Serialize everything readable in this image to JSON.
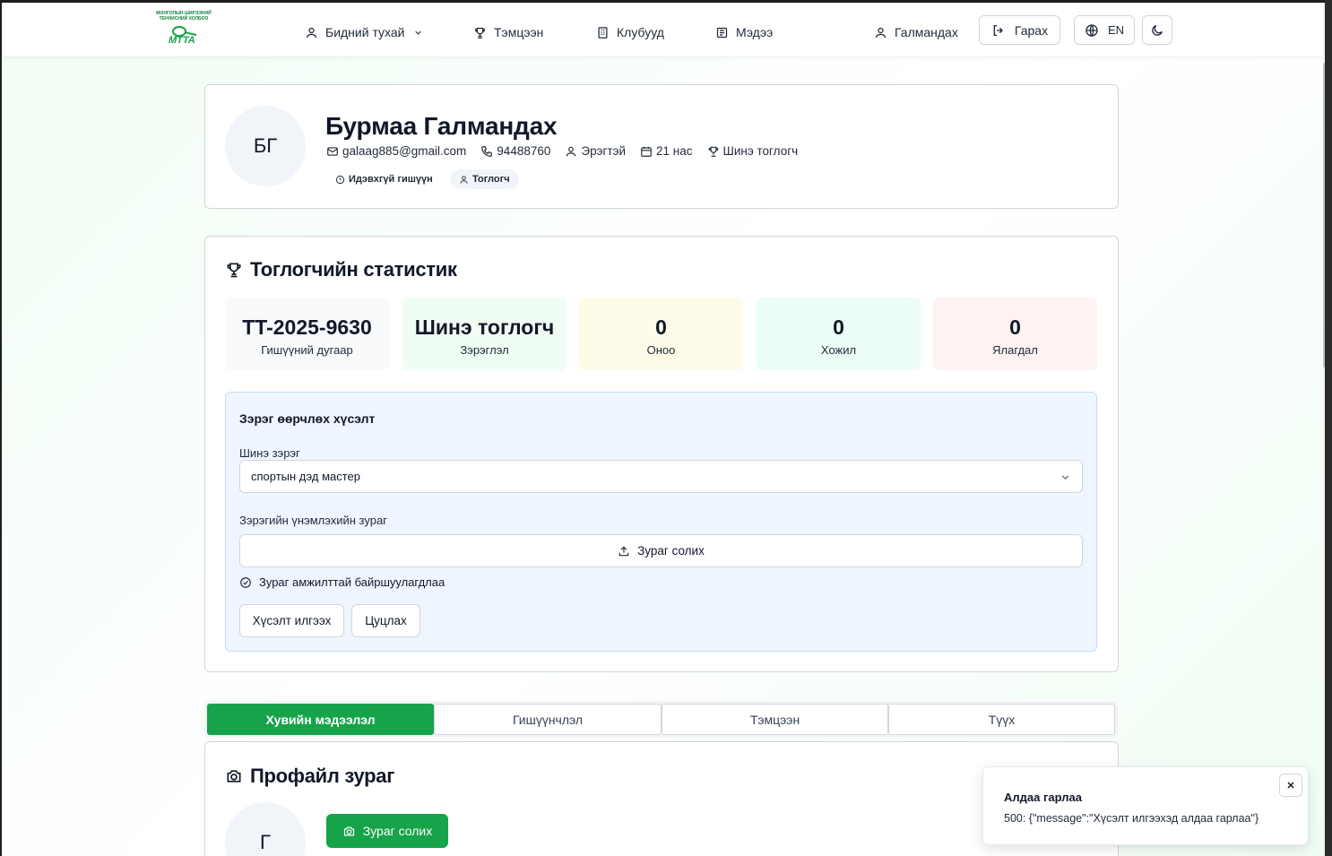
{
  "header": {
    "logo_caption": "МОНГОЛЫН ШИРЭЭНИЙ ТЕННИСНИЙ ХОЛБОО",
    "logo_text": "MTTA",
    "nav": {
      "about": "Бидний тухай",
      "tournaments": "Тэмцээн",
      "clubs": "Клубууд",
      "news": "Мэдээ"
    },
    "user_name": "Галмандах",
    "logout": "Гарах",
    "language": "EN"
  },
  "profile": {
    "initials": "БГ",
    "full_name": "Бурмаа Галмандах",
    "email": "galaag885@gmail.com",
    "phone": "94488760",
    "gender": "Эрэгтэй",
    "age": "21 нас",
    "rank": "Шинэ тоглогч",
    "status_badge": "Идэвхгүй гишүүн",
    "role_badge": "Тоглогч"
  },
  "stats": {
    "title": "Тоглогчийн статистик",
    "items": [
      {
        "value": "TT-2025-9630",
        "label": "Гишүүний дугаар",
        "color": "#f8fafc"
      },
      {
        "value": "Шинэ тоглогч",
        "label": "Зэрэглэл",
        "color": "#f0fdf4"
      },
      {
        "value": "0",
        "label": "Оноо",
        "color": "#fefce8"
      },
      {
        "value": "0",
        "label": "Хожил",
        "color": "#ecfdf5"
      },
      {
        "value": "0",
        "label": "Ялагдал",
        "color": "#fef2f2"
      }
    ]
  },
  "rank_request": {
    "title": "Зэрэг өөрчлөх хүсэлт",
    "new_rank_label": "Шинэ зэрэг",
    "new_rank_value": "спортын дэд мастер",
    "certificate_label": "Зэрэгийн үнэмлэхийн зураг",
    "upload_label": "Зураг солих",
    "upload_success": "Зураг амжилттай байршуулагдлаа",
    "submit": "Хүсэлт илгээх",
    "cancel": "Цуцлах"
  },
  "tabs": [
    "Хувийн мэдээлэл",
    "Гишүүнчлэл",
    "Тэмцээн",
    "Түүх"
  ],
  "profile_photo": {
    "title": "Профайл зураг",
    "initial": "Г",
    "change_button": "Зураг солих"
  },
  "toast": {
    "title": "Алдаа гарлаа",
    "message": "500: {\"message\":\"Хүсэлт илгээхэд алдаа гарлаа\"}"
  },
  "colors": {
    "accent": "#16a34a",
    "request_bg": "#eff6ff"
  }
}
